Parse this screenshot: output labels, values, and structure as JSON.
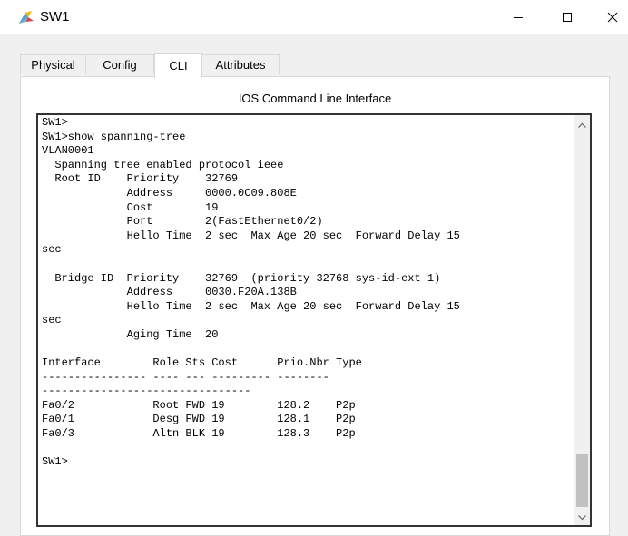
{
  "window": {
    "title": "SW1",
    "app_icon": "packet-tracer-icon",
    "controls": [
      "minimize-icon",
      "maximize-icon",
      "close-icon"
    ]
  },
  "tabs": [
    {
      "label": "Physical",
      "active": false
    },
    {
      "label": "Config",
      "active": false
    },
    {
      "label": "CLI",
      "active": true
    },
    {
      "label": "Attributes",
      "active": false
    }
  ],
  "panel": {
    "heading": "IOS Command Line Interface"
  },
  "terminal": {
    "lines": [
      "SW1>",
      "SW1>show spanning-tree",
      "VLAN0001",
      "  Spanning tree enabled protocol ieee",
      "  Root ID    Priority    32769",
      "             Address     0000.0C09.808E",
      "             Cost        19",
      "             Port        2(FastEthernet0/2)",
      "             Hello Time  2 sec  Max Age 20 sec  Forward Delay 15",
      "sec",
      "",
      "  Bridge ID  Priority    32769  (priority 32768 sys-id-ext 1)",
      "             Address     0030.F20A.138B",
      "             Hello Time  2 sec  Max Age 20 sec  Forward Delay 15",
      "sec",
      "             Aging Time  20",
      "",
      "Interface        Role Sts Cost      Prio.Nbr Type",
      "---------------- ---- --- --------- --------",
      "--------------------------------",
      "Fa0/2            Root FWD 19        128.2    P2p",
      "Fa0/1            Desg FWD 19        128.1    P2p",
      "Fa0/3            Altn BLK 19        128.3    P2p",
      "",
      "SW1>"
    ]
  },
  "scrollbar": {
    "position": 1.0
  }
}
